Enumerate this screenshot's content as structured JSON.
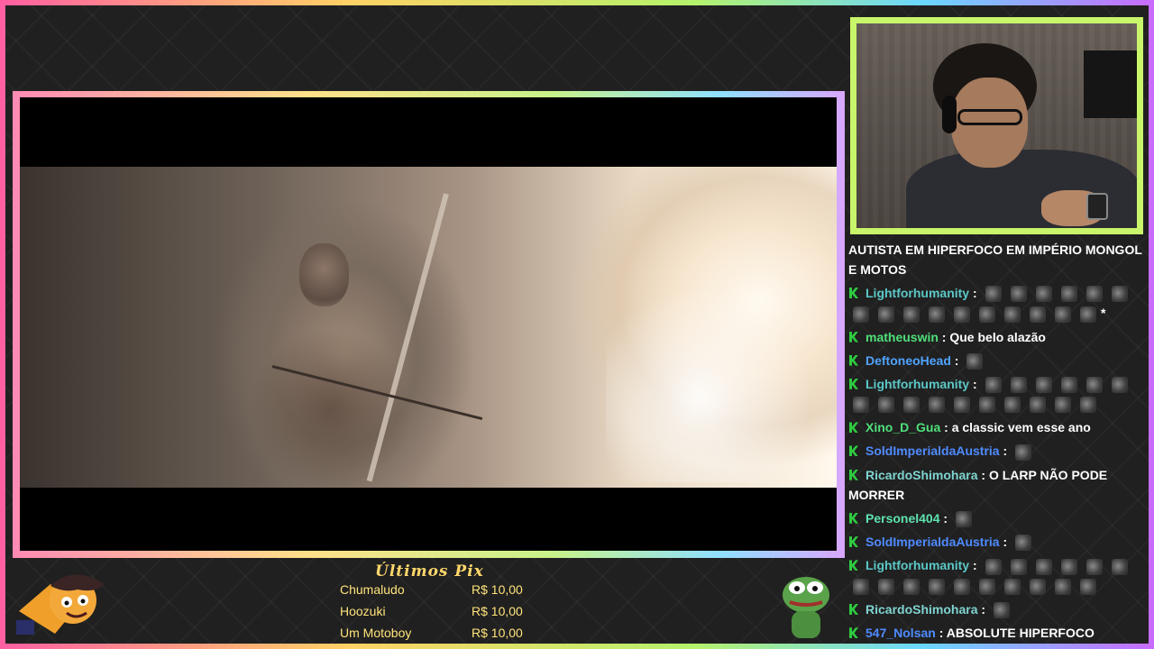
{
  "stream": {
    "accent_colors": [
      "#ff5fa2",
      "#ffd166",
      "#b5f26b",
      "#6ad7ff",
      "#c86bff"
    ]
  },
  "chat": {
    "title": "AUTISTA EM HIPERFOCO EM IMPÉRIO MONGOL E MOTOS",
    "messages": [
      {
        "user": "Lightforhumanity",
        "color": "#5cc7c7",
        "text": "",
        "emotes": 16,
        "suffix": "*"
      },
      {
        "user": "matheuswin",
        "color": "#4fe07a",
        "text": "Que belo alazão",
        "emotes": 0,
        "suffix": ""
      },
      {
        "user": "DeftoneoHead",
        "color": "#4fa3ff",
        "text": "",
        "emotes": 1,
        "suffix": ""
      },
      {
        "user": "Lightforhumanity",
        "color": "#5cc7c7",
        "text": "",
        "emotes": 16,
        "suffix": ""
      },
      {
        "user": "Xino_D_Gua",
        "color": "#4fe07a",
        "text": "a classic vem esse ano",
        "emotes": 0,
        "suffix": ""
      },
      {
        "user": "SoldImperialdaAustria",
        "color": "#4f8bff",
        "text": "",
        "emotes": 1,
        "suffix": ""
      },
      {
        "user": "RicardoShimohara",
        "color": "#7fd4d0",
        "text": "O LARP NÃO PODE MORRER",
        "emotes": 0,
        "suffix": ""
      },
      {
        "user": "Personel404",
        "color": "#5ee3b0",
        "text": "",
        "emotes": 1,
        "suffix": ""
      },
      {
        "user": "SoldImperialdaAustria",
        "color": "#4f8bff",
        "text": "",
        "emotes": 1,
        "suffix": ""
      },
      {
        "user": "Lightforhumanity",
        "color": "#5cc7c7",
        "text": "",
        "emotes": 16,
        "suffix": ""
      },
      {
        "user": "RicardoShimohara",
        "color": "#7fd4d0",
        "text": "",
        "emotes": 1,
        "suffix": ""
      },
      {
        "user": "547_Nolsan",
        "color": "#4f8bff",
        "text": "ABSOLUTE HIPERFOCO",
        "emotes": 0,
        "suffix": ""
      }
    ]
  },
  "donations": {
    "title": "Últimos Pix",
    "rows": [
      {
        "name": "Chumaludo",
        "amount": "R$ 10,00"
      },
      {
        "name": "Hoozuki",
        "amount": "R$ 10,00"
      },
      {
        "name": "Um Motoboy",
        "amount": "R$ 10,00"
      }
    ]
  }
}
